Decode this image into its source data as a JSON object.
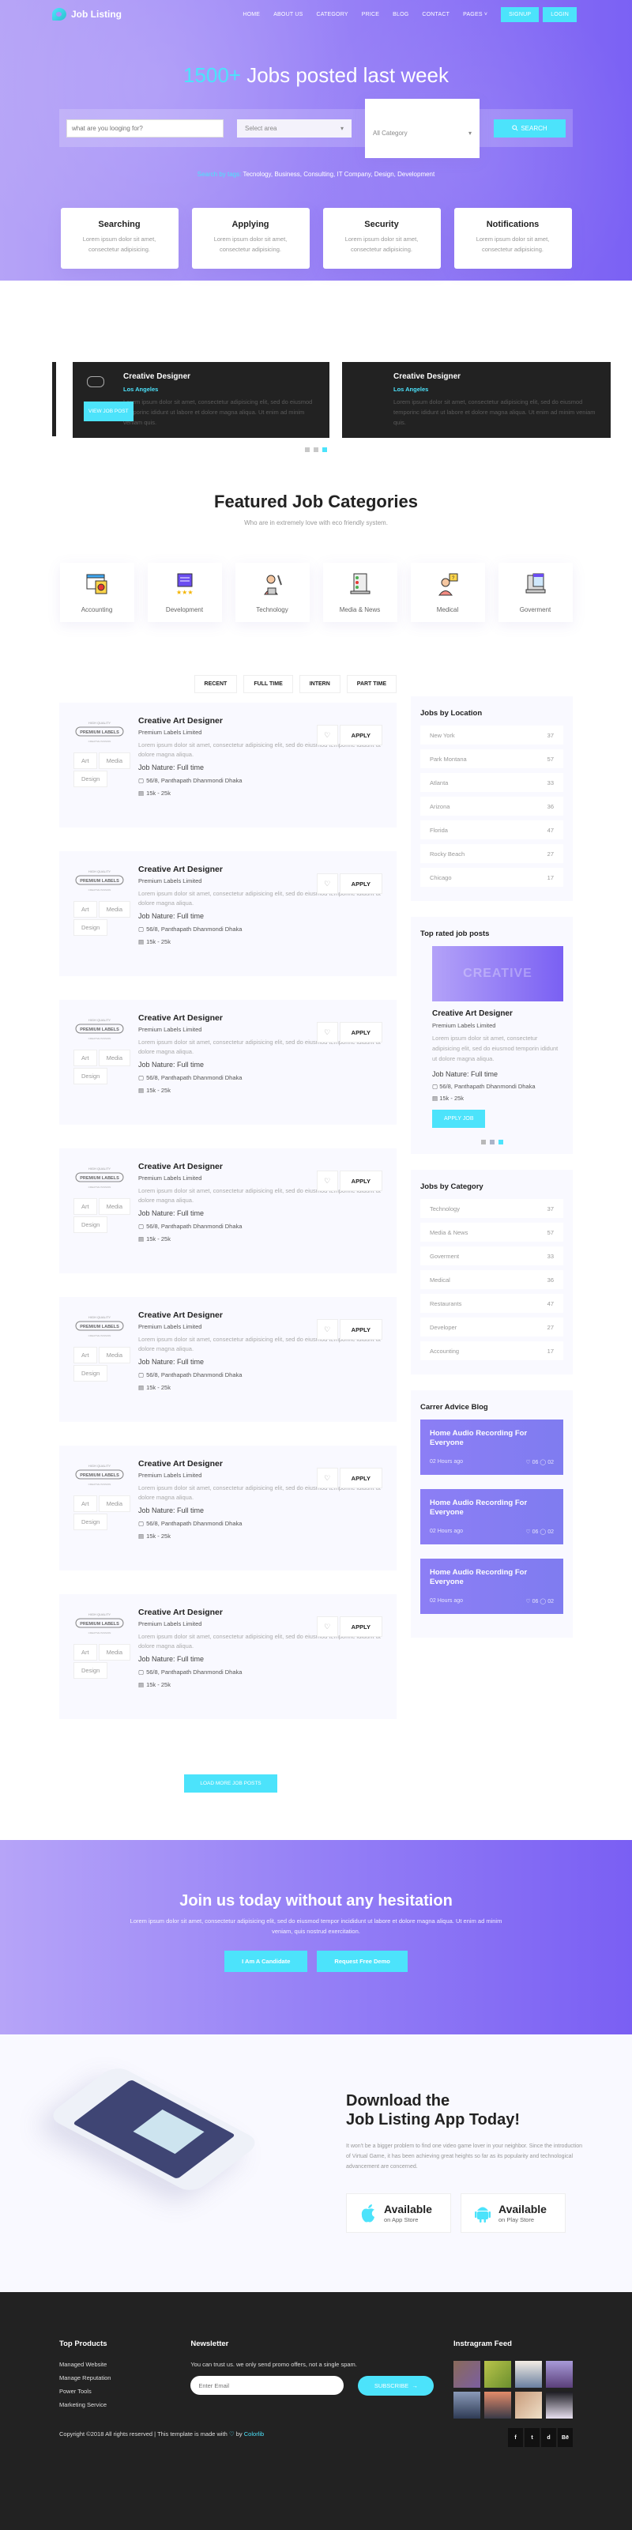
{
  "nav": {
    "brand": "Job Listing",
    "items": [
      "HOME",
      "ABOUT US",
      "CATEGORY",
      "PRICE",
      "BLOG",
      "CONTACT",
      "PAGES"
    ],
    "signup": "SIGNUP",
    "login": "LOGIN"
  },
  "hero": {
    "title_accent": "1500+",
    "title_rest": " Jobs posted last week",
    "search_placeholder": "what are you looging for?",
    "area_select": "Select area",
    "category_select": "All Category",
    "search_button": "SEARCH",
    "tags_label": "Search by tags:",
    "tags": " Tecnology, Business, Consulting, IT Company, Design, Development"
  },
  "features": [
    {
      "title": "Searching",
      "text": "Lorem ipsum dolor sit amet, consectetur adipisicing."
    },
    {
      "title": "Applying",
      "text": "Lorem ipsum dolor sit amet, consectetur adipisicing."
    },
    {
      "title": "Security",
      "text": "Lorem ipsum dolor sit amet, consectetur adipisicing."
    },
    {
      "title": "Notifications",
      "text": "Lorem ipsum dolor sit amet, consectetur adipisicing."
    }
  ],
  "carousel": {
    "slides": [
      {
        "title": "Creative Designer",
        "location": "Los Angeles",
        "text": "Lorem ipsum dolor sit amet, consectetur adipisicing elit, sed do eiusmod temporinc ididunt ut labore et dolore magna aliqua. Ut enim ad minim veniam quis."
      },
      {
        "title": "Creative Designer",
        "location": "Los Angeles",
        "text": "Lorem ipsum dolor sit amet, consectetur adipisicing elit, sed do eiusmod temporinc ididunt ut labore et dolore magna aliqua. Ut enim ad minim veniam quis."
      }
    ],
    "view_button": "VIEW JOB POST"
  },
  "categories": {
    "title": "Featured Job Categories",
    "subtitle": "Who are in extremely love with eco friendly system.",
    "items": [
      "Accounting",
      "Development",
      "Technology",
      "Media & News",
      "Medical",
      "Goverment"
    ]
  },
  "filters": [
    "RECENT",
    "FULL TIME",
    "INTERN",
    "PART TIME"
  ],
  "jobs": [
    {
      "title": "Creative Art Designer",
      "company": "Premium Labels Limited",
      "desc": "Lorem ipsum dolor sit amet, consectetur adipisicing elit, sed do eiusmod temporinc ididunt ut dolore magna aliqua.",
      "nature": "Job Nature: Full time",
      "address": "56/8, Panthapath Dhanmondi Dhaka",
      "salary": "15k - 25k",
      "tags": [
        "Art",
        "Media",
        "Design"
      ],
      "apply": "APPLY"
    },
    {
      "title": "Creative Art Designer",
      "company": "Premium Labels Limited",
      "desc": "Lorem ipsum dolor sit amet, consectetur adipisicing elit, sed do eiusmod temporinc ididunt ut dolore magna aliqua.",
      "nature": "Job Nature: Full time",
      "address": "56/8, Panthapath Dhanmondi Dhaka",
      "salary": "15k - 25k",
      "tags": [
        "Art",
        "Media",
        "Design"
      ],
      "apply": "APPLY"
    },
    {
      "title": "Creative Art Designer",
      "company": "Premium Labels Limited",
      "desc": "Lorem ipsum dolor sit amet, consectetur adipisicing elit, sed do eiusmod temporinc ididunt ut dolore magna aliqua.",
      "nature": "Job Nature: Full time",
      "address": "56/8, Panthapath Dhanmondi Dhaka",
      "salary": "15k - 25k",
      "tags": [
        "Art",
        "Media",
        "Design"
      ],
      "apply": "APPLY"
    },
    {
      "title": "Creative Art Designer",
      "company": "Premium Labels Limited",
      "desc": "Lorem ipsum dolor sit amet, consectetur adipisicing elit, sed do eiusmod temporinc ididunt ut dolore magna aliqua.",
      "nature": "Job Nature: Full time",
      "address": "56/8, Panthapath Dhanmondi Dhaka",
      "salary": "15k - 25k",
      "tags": [
        "Art",
        "Media",
        "Design"
      ],
      "apply": "APPLY"
    },
    {
      "title": "Creative Art Designer",
      "company": "Premium Labels Limited",
      "desc": "Lorem ipsum dolor sit amet, consectetur adipisicing elit, sed do eiusmod temporinc ididunt ut dolore magna aliqua.",
      "nature": "Job Nature: Full time",
      "address": "56/8, Panthapath Dhanmondi Dhaka",
      "salary": "15k - 25k",
      "tags": [
        "Art",
        "Media",
        "Design"
      ],
      "apply": "APPLY"
    },
    {
      "title": "Creative Art Designer",
      "company": "Premium Labels Limited",
      "desc": "Lorem ipsum dolor sit amet, consectetur adipisicing elit, sed do eiusmod temporinc ididunt ut dolore magna aliqua.",
      "nature": "Job Nature: Full time",
      "address": "56/8, Panthapath Dhanmondi Dhaka",
      "salary": "15k - 25k",
      "tags": [
        "Art",
        "Media",
        "Design"
      ],
      "apply": "APPLY"
    },
    {
      "title": "Creative Art Designer",
      "company": "Premium Labels Limited",
      "desc": "Lorem ipsum dolor sit amet, consectetur adipisicing elit, sed do eiusmod temporinc ididunt ut dolore magna aliqua.",
      "nature": "Job Nature: Full time",
      "address": "56/8, Panthapath Dhanmondi Dhaka",
      "salary": "15k - 25k",
      "tags": [
        "Art",
        "Media",
        "Design"
      ],
      "apply": "APPLY"
    }
  ],
  "load_more": "LOAD MORE JOB POSTS",
  "sidebar": {
    "location": {
      "title": "Jobs by Location",
      "rows": [
        {
          "name": "New York",
          "count": "37"
        },
        {
          "name": "Park Montana",
          "count": "57"
        },
        {
          "name": "Atlanta",
          "count": "33"
        },
        {
          "name": "Arizona",
          "count": "36"
        },
        {
          "name": "Florida",
          "count": "47"
        },
        {
          "name": "Rocky Beach",
          "count": "27"
        },
        {
          "name": "Chicago",
          "count": "17"
        }
      ]
    },
    "top_rated": {
      "title": "Top rated job posts",
      "image_text": "CREATIVE",
      "job_title": "Creative Art Designer",
      "company": "Premium Labels Limited",
      "desc": "Lorem ipsum dolor sit amet, consectetur adipisicing elit, sed do eiusmod temporin ididunt ut dolore magna aliqua.",
      "nature": "Job Nature: Full time",
      "address": "56/8, Panthapath Dhanmondi Dhaka",
      "salary": "15k - 25k",
      "button": "APPLY JOB"
    },
    "category": {
      "title": "Jobs by Category",
      "rows": [
        {
          "name": "Technology",
          "count": "37"
        },
        {
          "name": "Media & News",
          "count": "57"
        },
        {
          "name": "Goverment",
          "count": "33"
        },
        {
          "name": "Medical",
          "count": "36"
        },
        {
          "name": "Restaurants",
          "count": "47"
        },
        {
          "name": "Developer",
          "count": "27"
        },
        {
          "name": "Accounting",
          "count": "17"
        }
      ]
    },
    "blog": {
      "title": "Carrer Advice Blog",
      "posts": [
        {
          "title": "Home Audio Recording For Everyone",
          "time": "02 Hours ago",
          "likes": "06",
          "comments": "02"
        },
        {
          "title": "Home Audio Recording For Everyone",
          "time": "02 Hours ago",
          "likes": "06",
          "comments": "02"
        },
        {
          "title": "Home Audio Recording For Everyone",
          "time": "02 Hours ago",
          "likes": "06",
          "comments": "02"
        }
      ]
    }
  },
  "cta": {
    "title": "Join us today without any hesitation",
    "text": "Lorem ipsum dolor sit amet, consectetur adipisicing elit, sed do eiusmod tempor incididunt ut labore et dolore magna aliqua. Ut enim ad minim veniam, quis nostrud exercitation.",
    "candidate": "I Am A Candidate",
    "demo": "Request Free Demo"
  },
  "app": {
    "title_line1": "Download the",
    "title_line2": "Job Listing App Today!",
    "text": "It won't be a bigger problem to find one video game lover in your neighbor. Since the introduction of Virtual Game, it has been achieving great heights so far as its popularity and technological advancement are concerned.",
    "apple_title": "Available",
    "apple_sub": "on App Store",
    "android_title": "Available",
    "android_sub": "on Play Store"
  },
  "footer": {
    "products_title": "Top Products",
    "products": [
      "Managed Website",
      "Manage Reputation",
      "Power Tools",
      "Marketing Service"
    ],
    "newsletter_title": "Newsletter",
    "newsletter_text": "You can trust us. we only send promo offers, not a single spam.",
    "email_placeholder": "Enter Email",
    "subscribe": "SUBSCRIBE",
    "instagram_title": "Instragram Feed",
    "copyright": "Copyright ©2018 All rights reserved | This template is made with ",
    "by": " by ",
    "brand": "Colorlib",
    "social": [
      "f",
      "t",
      "d",
      "Bē"
    ]
  },
  "colors": {
    "accent": "#4ce3fb",
    "purple_start": "#b5a3f7",
    "purple_end": "#7b61f4",
    "dark": "#222222"
  }
}
